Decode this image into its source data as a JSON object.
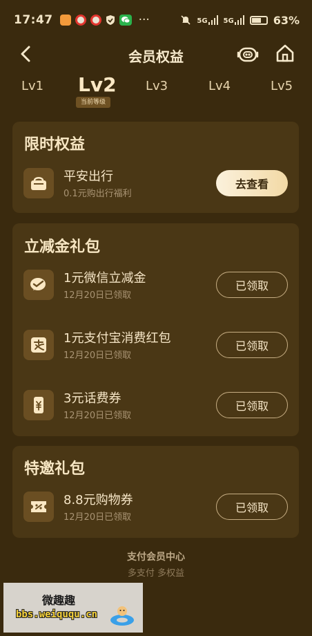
{
  "status_bar": {
    "time": "17:47",
    "more": "···",
    "battery": "63%",
    "signal1": "5G",
    "signal2": "5G",
    "app_icons": [
      "orange-app-icon",
      "weibo-icon",
      "weibo-icon",
      "shield-icon",
      "wechat-icon"
    ]
  },
  "nav": {
    "title": "会员权益",
    "back_icon": "chevron-left-icon",
    "bot_icon": "robot-icon",
    "home_icon": "home-icon"
  },
  "levels": {
    "items": [
      "Lv1",
      "Lv2",
      "Lv3",
      "Lv4",
      "Lv5"
    ],
    "current_badge": "当前等级"
  },
  "sections": [
    {
      "title": "限时权益",
      "items": [
        {
          "title": "平安出行",
          "subtitle": "0.1元购出行福利",
          "button": "去查看",
          "icon": "basket-icon"
        }
      ]
    },
    {
      "title": "立减金礼包",
      "items": [
        {
          "title": "1元微信立减金",
          "subtitle": "12月20日已领取",
          "button": "已领取",
          "icon": "wechat-pay-icon"
        },
        {
          "title": "1元支付宝消费红包",
          "subtitle": "12月20日已领取",
          "button": "已领取",
          "icon": "alipay-icon"
        },
        {
          "title": "3元话费券",
          "subtitle": "12月20日已领取",
          "button": "已领取",
          "icon": "phone-yuan-icon"
        }
      ]
    },
    {
      "title": "特邀礼包",
      "items": [
        {
          "title": "8.8元购物券",
          "subtitle": "12月20日已领取",
          "button": "已领取",
          "icon": "coupon-icon"
        }
      ]
    }
  ],
  "footer": {
    "title": "支付会员中心",
    "subtitle": "多支付 多权益"
  },
  "watermark": {
    "name": "微趣趣",
    "url": "bbs.weiququ.cn"
  },
  "colors": {
    "background": "#3a2a0e",
    "card": "#4a3715",
    "accent_text": "#f7e6c3",
    "muted_text": "#a99474"
  }
}
